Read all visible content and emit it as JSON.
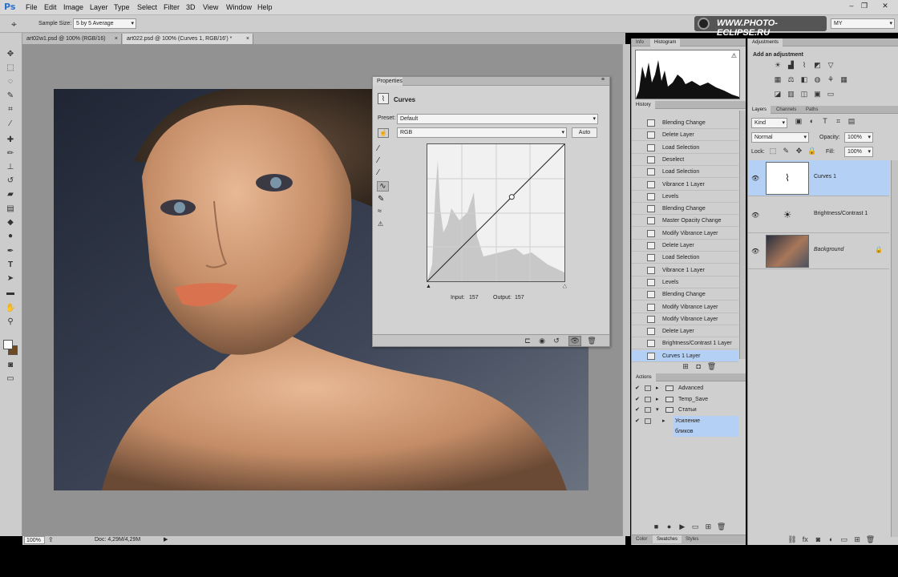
{
  "app": {
    "logo": "Ps"
  },
  "menu": [
    "File",
    "Edit",
    "Image",
    "Layer",
    "Type",
    "Select",
    "Filter",
    "3D",
    "View",
    "Window",
    "Help"
  ],
  "window_buttons": [
    "–",
    "❐",
    "✕"
  ],
  "options_bar": {
    "sample_size_label": "Sample Size:",
    "sample_size_value": "5 by 5 Average",
    "watermark": "WWW.PHOTO-ECLIPSE.RU",
    "workspace": "MY"
  },
  "doc_tabs": [
    {
      "label": "art02w1.psd @ 100% (RGB/16)",
      "close": "×"
    },
    {
      "label": "art022.psd @ 100% (Curves 1, RGB/16') *",
      "close": "×"
    }
  ],
  "status": {
    "zoom": "100%",
    "doc": "Doc: 4,29M/4,29M"
  },
  "properties": {
    "title": "Properties",
    "section": "Curves",
    "preset_label": "Preset:",
    "preset_value": "Default",
    "channel_value": "RGB",
    "auto_label": "Auto",
    "input_label": "Input:",
    "input_value": "157",
    "output_label": "Output:",
    "output_value": "157",
    "curve_point": {
      "input": 157,
      "output": 157
    }
  },
  "panels": {
    "info_tab": "Info",
    "histogram_tab": "Histogram",
    "adjustments_tab": "Adjustments",
    "adjustments_title": "Add an adjustment",
    "history_tab": "History",
    "actions_tab": "Actions",
    "layers_tab": "Layers",
    "channels_tab": "Channels",
    "paths_tab": "Paths",
    "color_tab": "Color",
    "swatches_tab": "Swatches",
    "styles_tab": "Styles"
  },
  "history": [
    "Blending Change",
    "Delete Layer",
    "Load Selection",
    "Deselect",
    "Load Selection",
    "Vibrance 1 Layer",
    "Levels",
    "Blending Change",
    "Master Opacity Change",
    "Modify Vibrance Layer",
    "Delete Layer",
    "Load Selection",
    "Vibrance 1 Layer",
    "Levels",
    "Blending Change",
    "Modify Vibrance Layer",
    "Modify Vibrance Layer",
    "Delete Layer",
    "Brightness/Contrast 1 Layer",
    "Curves 1 Layer"
  ],
  "actions": [
    "Advanced",
    "Temp_Save",
    "Статьи",
    "Усиление бликов"
  ],
  "layers": {
    "kind_label": "Kind",
    "blend_mode": "Normal",
    "opacity_label": "Opacity:",
    "opacity_value": "100%",
    "lock_label": "Lock:",
    "fill_label": "Fill:",
    "fill_value": "100%",
    "items": [
      {
        "name": "Curves 1",
        "selected": true
      },
      {
        "name": "Brightness/Contrast 1",
        "selected": false
      },
      {
        "name": "Background",
        "selected": false
      }
    ]
  },
  "colors": {
    "selection": "#b5d0f5",
    "menubar": "#d8d8d8",
    "canvas_bg": "#929292"
  }
}
